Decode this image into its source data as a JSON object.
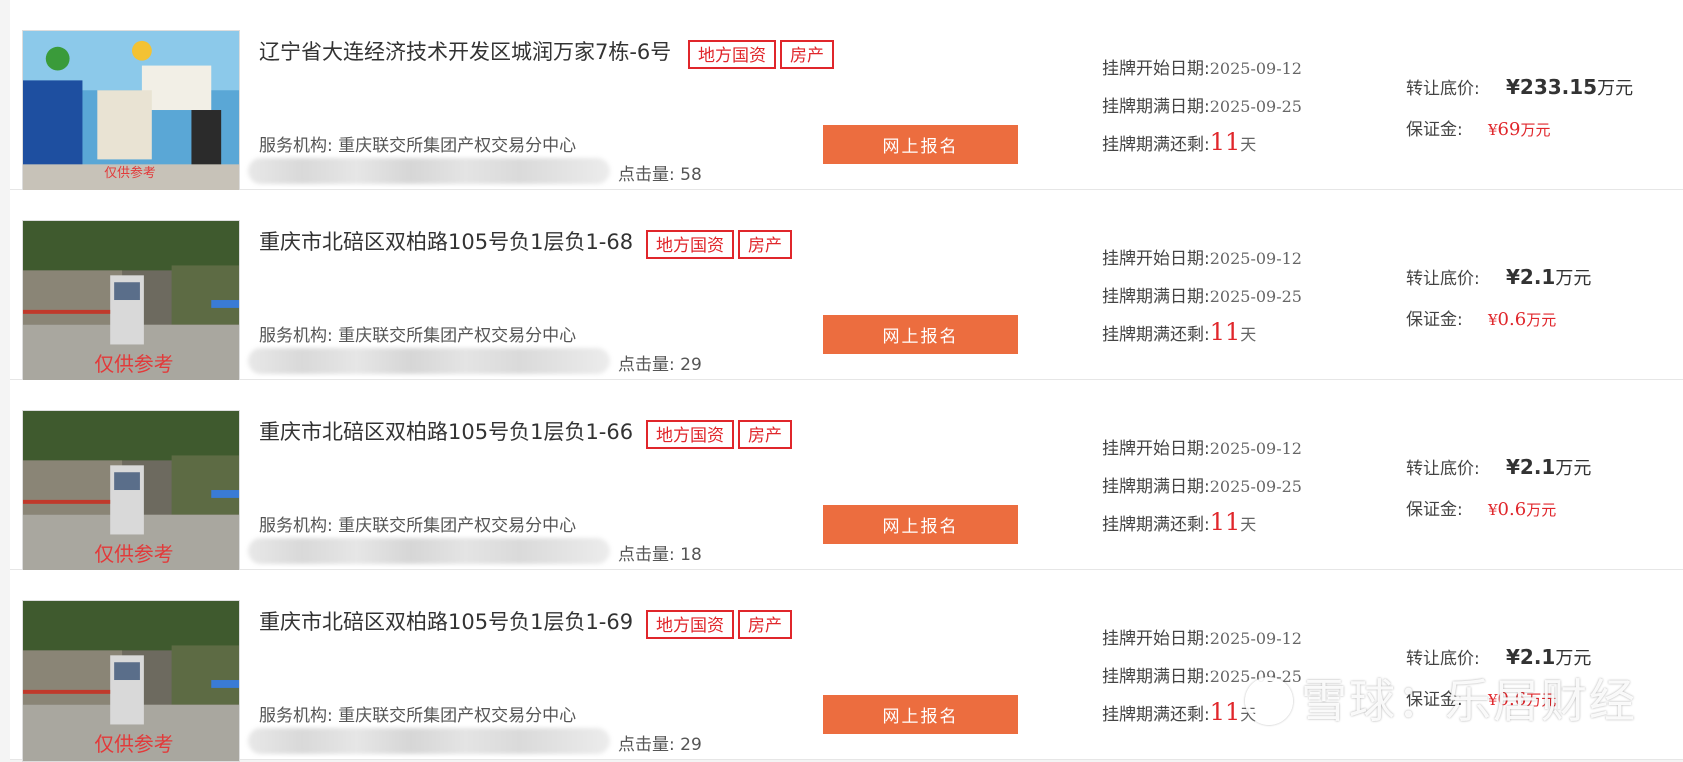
{
  "listings": [
    {
      "title": "辽宁省大连经济技术开发区城润万家7栋-6号",
      "tags": [
        "地方国资",
        "房产"
      ],
      "org_label": "服务机构: ",
      "org": "重庆联交所集团产权交易分中心",
      "clicks_label": "点击量: ",
      "clicks": "58",
      "button": "网上报名",
      "start_label": "挂牌开始日期:",
      "start_date": "2025-09-12",
      "end_label": "挂牌期满日期:",
      "end_date": "2025-09-25",
      "remain_label": "挂牌期满还剩:",
      "remain_days": "11",
      "remain_unit": "天",
      "price_label": "转让底价:",
      "price_yen": "¥",
      "price": "233.15",
      "price_unit": "万元",
      "deposit_label": "保证金:",
      "deposit_yen": "¥",
      "deposit": "69",
      "deposit_unit": "万元",
      "thumb_caption": "仅供参考"
    },
    {
      "title": "重庆市北碚区双柏路105号负1层负1-68",
      "tags": [
        "地方国资",
        "房产"
      ],
      "org_label": "服务机构: ",
      "org": "重庆联交所集团产权交易分中心",
      "clicks_label": "点击量: ",
      "clicks": "29",
      "button": "网上报名",
      "start_label": "挂牌开始日期:",
      "start_date": "2025-09-12",
      "end_label": "挂牌期满日期:",
      "end_date": "2025-09-25",
      "remain_label": "挂牌期满还剩:",
      "remain_days": "11",
      "remain_unit": "天",
      "price_label": "转让底价:",
      "price_yen": "¥",
      "price": "2.1",
      "price_unit": "万元",
      "deposit_label": "保证金:",
      "deposit_yen": "¥",
      "deposit": "0.6",
      "deposit_unit": "万元",
      "thumb_caption": "仅供参考"
    },
    {
      "title": "重庆市北碚区双柏路105号负1层负1-66",
      "tags": [
        "地方国资",
        "房产"
      ],
      "org_label": "服务机构: ",
      "org": "重庆联交所集团产权交易分中心",
      "clicks_label": "点击量: ",
      "clicks": "18",
      "button": "网上报名",
      "start_label": "挂牌开始日期:",
      "start_date": "2025-09-12",
      "end_label": "挂牌期满日期:",
      "end_date": "2025-09-25",
      "remain_label": "挂牌期满还剩:",
      "remain_days": "11",
      "remain_unit": "天",
      "price_label": "转让底价:",
      "price_yen": "¥",
      "price": "2.1",
      "price_unit": "万元",
      "deposit_label": "保证金:",
      "deposit_yen": "¥",
      "deposit": "0.6",
      "deposit_unit": "万元",
      "thumb_caption": "仅供参考"
    },
    {
      "title": "重庆市北碚区双柏路105号负1层负1-69",
      "tags": [
        "地方国资",
        "房产"
      ],
      "org_label": "服务机构: ",
      "org": "重庆联交所集团产权交易分中心",
      "clicks_label": "点击量: ",
      "clicks": "29",
      "button": "网上报名",
      "start_label": "挂牌开始日期:",
      "start_date": "2025-09-12",
      "end_label": "挂牌期满日期:",
      "end_date": "2025-09-25",
      "remain_label": "挂牌期满还剩:",
      "remain_days": "11",
      "remain_unit": "天",
      "price_label": "转让底价:",
      "price_yen": "¥",
      "price": "2.1",
      "price_unit": "万元",
      "deposit_label": "保证金:",
      "deposit_yen": "¥",
      "deposit": "0.6",
      "deposit_unit": "万元",
      "thumb_caption": "仅供参考"
    }
  ],
  "watermark": "雪球：乐居财经",
  "colors": {
    "accent_red": "#e0262b",
    "button_orange": "#ec6d3f"
  }
}
